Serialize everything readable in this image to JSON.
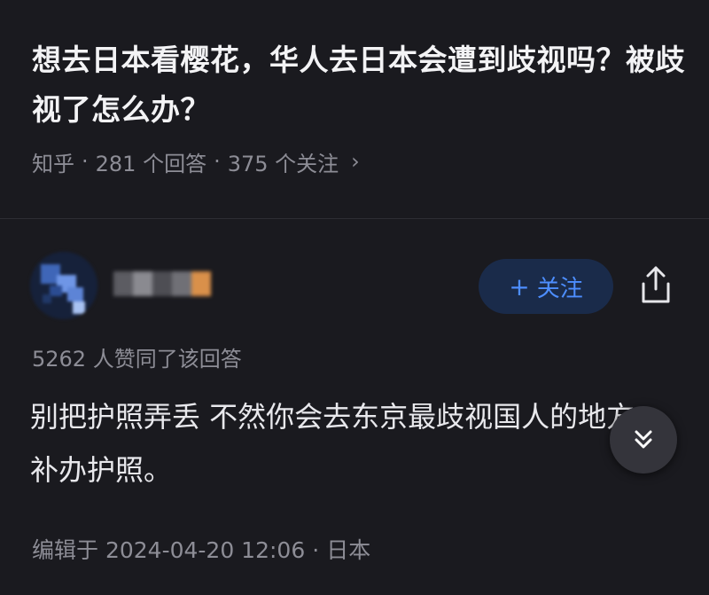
{
  "question": {
    "title": "想去日本看樱花，华人去日本会遭到歧视吗？被歧视了怎么办？",
    "source": "知乎",
    "separator": "·",
    "answers_count": "281 个回答",
    "followers_count": "375 个关注",
    "chevron": "›"
  },
  "answer": {
    "follow_icon": "+",
    "follow_label": "关注",
    "share_icon": "share-icon",
    "upvote_summary": "5262 人赞同了该回答",
    "content": "别把护照弄丢 不然你会去东京最歧视国人的地方 补办护照。",
    "edited_label": "编辑于 2024-04-20 12:06",
    "location": "日本",
    "scroll_icon": "chevron-double-down-icon"
  },
  "colors": {
    "background": "#1a1a1f",
    "accent": "#4d8eff",
    "follow_bg": "#1a2b4a",
    "secondary_text": "#8d8d96"
  }
}
